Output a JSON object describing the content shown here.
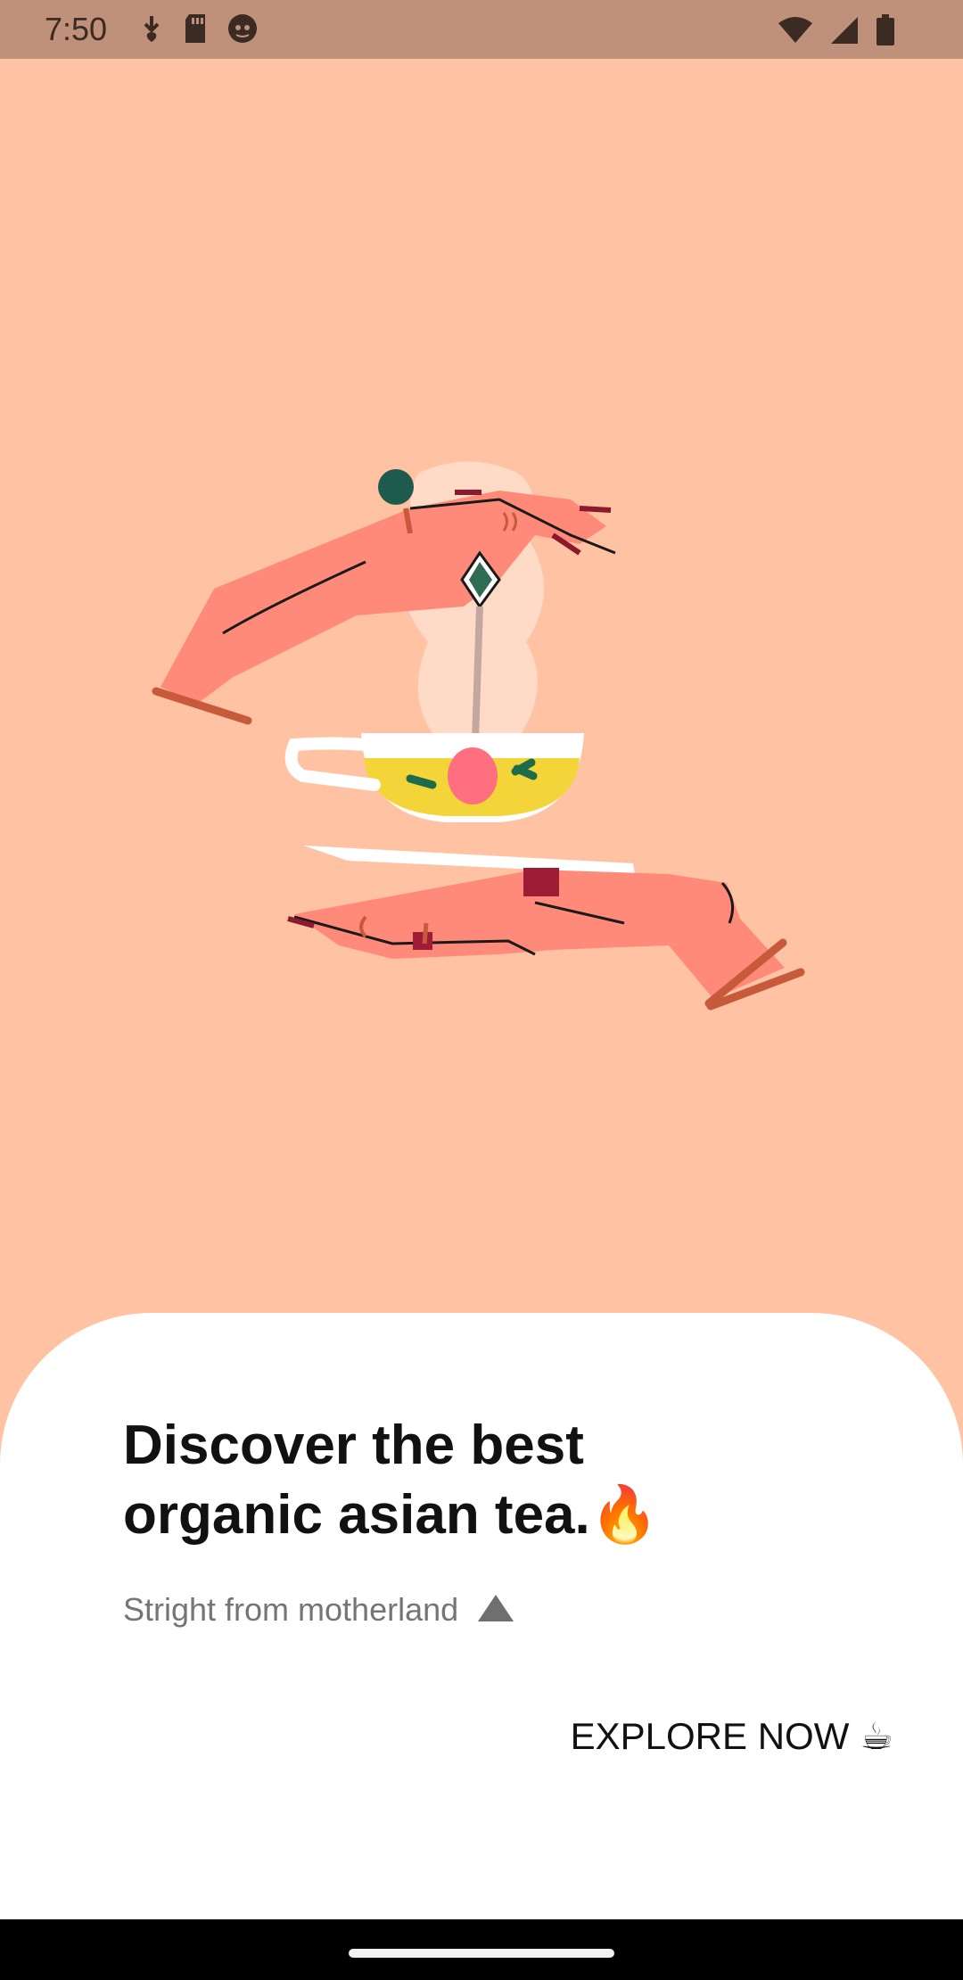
{
  "status_bar": {
    "time": "7:50",
    "bg_color": "#BF917A"
  },
  "hero": {
    "bg_color": "#FFC3A4",
    "illustration": "hands-holding-tea-cup-and-saucer"
  },
  "content": {
    "headline_line1": "Discover the best",
    "headline_line2": "organic asian tea.",
    "headline_emoji": "🔥",
    "subtitle": "Stright from motherland",
    "subtitle_icon": "triangle-icon"
  },
  "cta": {
    "label": "EXPLORE NOW",
    "emoji": "☕"
  }
}
